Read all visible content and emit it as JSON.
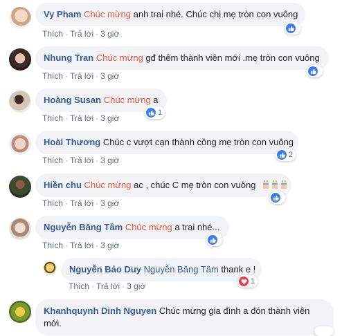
{
  "actions": {
    "like": "Thích",
    "reply": "Trả lời",
    "separator": "·"
  },
  "comments": [
    {
      "author": "Vy Pham",
      "highlight": "Chúc mừng",
      "text": " anh trai nhé. Chúc chị mẹ tròn con vuông",
      "time": "3 giờ",
      "reaction": "like",
      "count": ""
    },
    {
      "author": "Nhung Tran",
      "highlight": "Chúc mừng",
      "text": " gđ thêm thành viên mới .mẹ tròn con vuông",
      "time": "3 giờ",
      "reaction": "like",
      "count": ""
    },
    {
      "author": "Hoàng Susan",
      "highlight": "Chúc mừng",
      "text": " a",
      "time": "3 giờ",
      "reaction": "like",
      "count": "1"
    },
    {
      "author": "Hoài Thương",
      "highlight": "",
      "text": " Chúc c vượt cạn thành công mẹ tròn con vuông",
      "time": "3 giờ",
      "reaction": "like",
      "count": "2"
    },
    {
      "author": "Hiền chu",
      "highlight": "Chúc mừng",
      "text": " ac , chúc C mẹ tròn con vuông",
      "time": "3 giờ",
      "reaction": "like",
      "count": ""
    },
    {
      "author": "Nguyễn Băng Tâm",
      "highlight": "Chúc mừng",
      "text": " a trai nhé...",
      "time": "3 giờ",
      "reaction": "like",
      "count": ""
    }
  ],
  "reply": {
    "author": "Nguyễn Bảo Duy",
    "tag": "Nguyễn Băng Tâm",
    "text": " thank e !",
    "time": "3 giờ",
    "reaction": "love",
    "count": "1"
  },
  "last": {
    "author": "Khanhquynh Dinh Nguyen",
    "text": " Chúc mừng gia đình a đón thành viên mới."
  },
  "colors": {
    "author": "#385898",
    "highlight": "#e9573f",
    "like": "#3b7bf0",
    "love": "#f0384e",
    "bubble": "#f2f3f5"
  }
}
